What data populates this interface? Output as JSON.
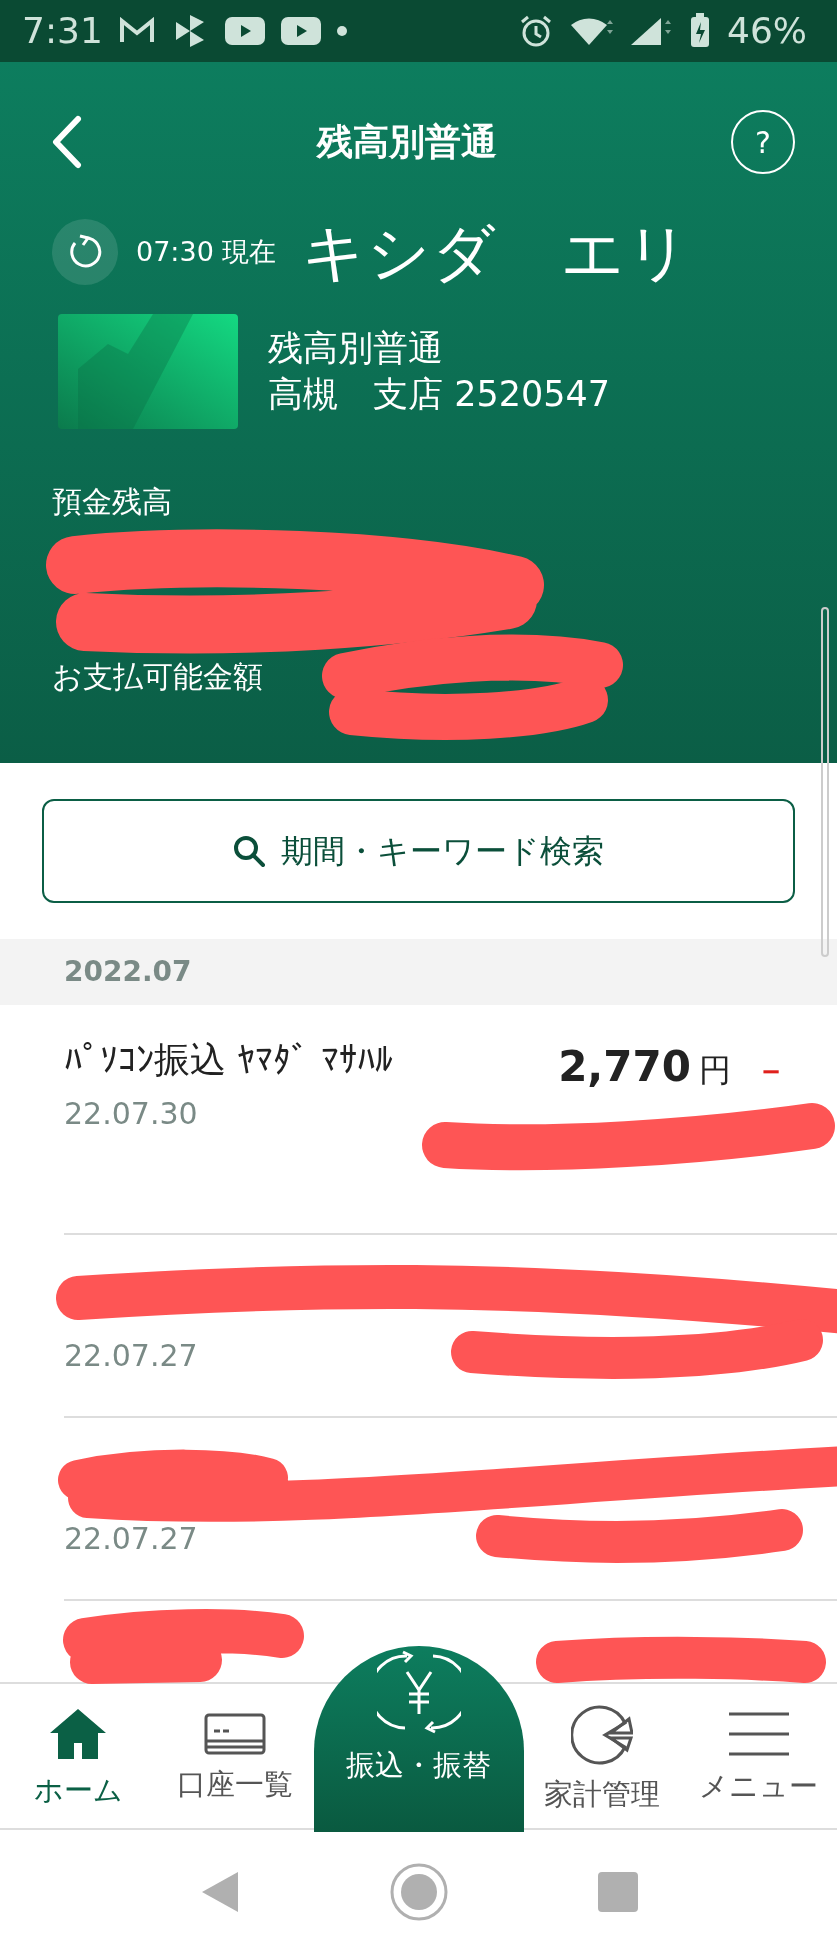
{
  "status_bar": {
    "time": "7:31",
    "battery": "46%"
  },
  "header": {
    "title": "残高別普通",
    "help_label": "?",
    "updated": "07:30 現在",
    "holder": "キシダ　エリ",
    "account_type": "残高別普通",
    "branch": "高槻　支店 2520547",
    "balance_label": "預金残高",
    "available_label": "お支払可能金額"
  },
  "search_button": {
    "label": "期間・キーワード検索"
  },
  "month": "2022.07",
  "transactions": [
    {
      "name": "ﾊﾟｿｺﾝ振込 ﾔﾏﾀﾞ ﾏｻﾊﾙ",
      "amount": "2,770",
      "currency": "円",
      "sign": "－",
      "date": "22.07.30"
    },
    {
      "date": "22.07.27"
    },
    {
      "date": "22.07.27"
    }
  ],
  "bottom_nav": [
    {
      "label": "ホーム",
      "kind": "home",
      "selected": true
    },
    {
      "label": "口座一覧",
      "kind": "accounts",
      "selected": false
    },
    {
      "label": "振込・振替",
      "kind": "transfer",
      "selected": false
    },
    {
      "label": "家計管理",
      "kind": "budget",
      "selected": false
    },
    {
      "label": "メニュー",
      "kind": "menu",
      "selected": false
    }
  ]
}
